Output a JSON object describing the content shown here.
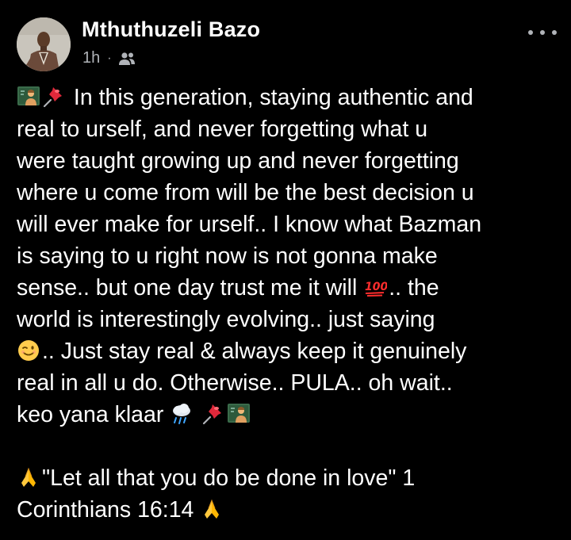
{
  "post": {
    "author_name": "Mthuthuzeli Bazo",
    "timestamp": "1h",
    "separator": "·",
    "audience_icon": "friends-icon",
    "menu_icon": "more-options-icon",
    "body_line1": "In this generation, staying authentic and",
    "body_rest": "real to urself, and never forgetting what u\nwere taught growing up and never forgetting\nwhere u come from will be the best decision u\nwill ever make for urself.. I know what Bazman\nis saying to u right now is not gonna make\nsense.. but one day trust me it will ",
    "body_after_100": ".. the\nworld is interestingly evolving.. just saying\n",
    "body_after_wink": ".. Just stay real & always keep it genuinely\nreal in all u do. Otherwise.. PULA.. oh wait..\nkeo yana klaar ",
    "quote_text": "\"Let all that you do be done in love\" 1\nCorinthians 16:14 "
  },
  "colors": {
    "background": "#000000",
    "text": "#ffffff",
    "secondary_text": "#b0b3b8"
  }
}
